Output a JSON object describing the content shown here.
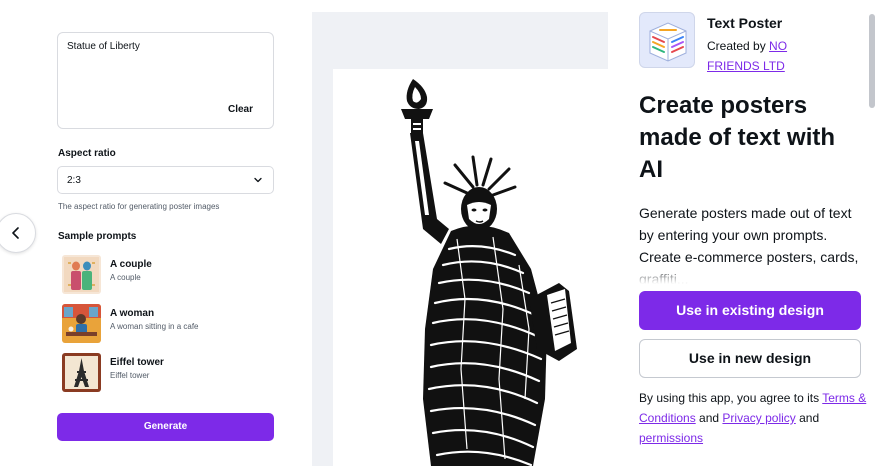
{
  "left_panel": {
    "prompt_value": "Statue of Liberty",
    "clear_label": "Clear",
    "aspect_ratio_label": "Aspect ratio",
    "aspect_ratio_value": "2:3",
    "aspect_ratio_helper": "The aspect ratio for generating poster images",
    "sample_prompts_label": "Sample prompts",
    "samples": [
      {
        "title": "A couple",
        "subtitle": "A couple"
      },
      {
        "title": "A woman",
        "subtitle": "A woman sitting in a cafe"
      },
      {
        "title": "Eiffel tower",
        "subtitle": "Eiffel tower"
      }
    ],
    "generate_label": "Generate"
  },
  "right_panel": {
    "app_name": "Text Poster",
    "created_by_prefix": "Created by",
    "author": "NO FRIENDS LTD",
    "headline": "Create posters made of text with AI",
    "description": "Generate posters made out of text by entering your own prompts. Create e-commerce posters, cards, graffiti...",
    "use_existing_label": "Use in existing design",
    "use_new_label": "Use in new design",
    "terms_prefix": "By using this app, you agree to its",
    "terms_link": "Terms & Conditions",
    "terms_and": "and",
    "privacy_link": "Privacy policy",
    "terms_and2": "and",
    "permissions_link": "permissions"
  },
  "colors": {
    "accent": "#7d2ae8",
    "canvas_bg": "#eff1f5",
    "text": "#0e1318",
    "muted": "#525b67"
  },
  "icons": [
    "chevron-left-icon",
    "chevron-down-icon"
  ]
}
